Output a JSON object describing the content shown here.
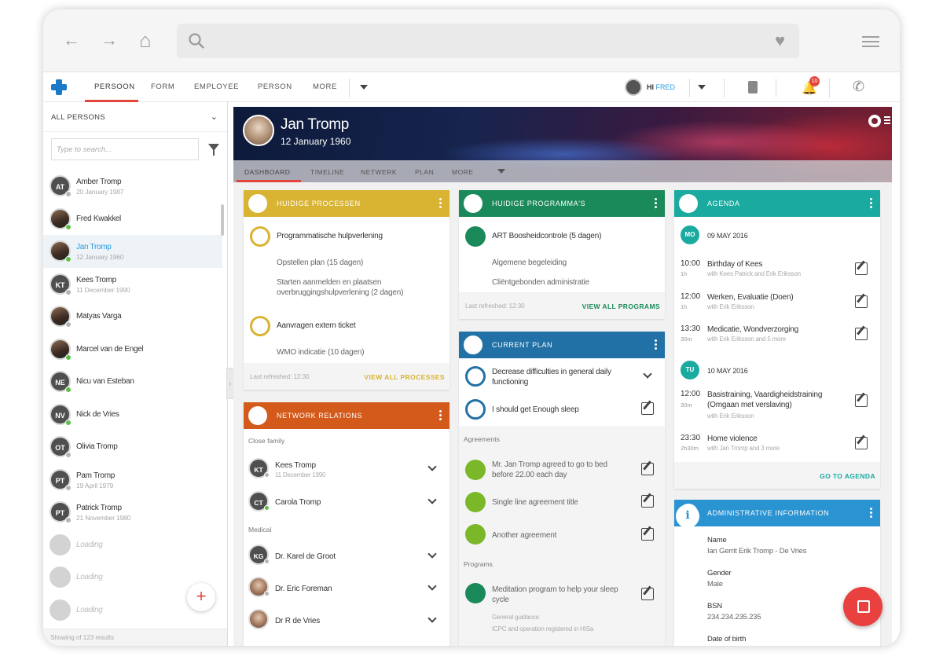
{
  "browser": {
    "back": "←",
    "forward": "→",
    "home": "⌂",
    "heart": "♥"
  },
  "app": {
    "tabs": [
      "PERSOON",
      "FORM",
      "EMPLOYEE",
      "PERSON",
      "MORE"
    ],
    "user": {
      "greeting": "HI ",
      "name": "FRED"
    },
    "notifications": "10"
  },
  "sidebar": {
    "filter_label": "ALL PERSONS",
    "search_placeholder": "Type to search...",
    "people": [
      {
        "initials": "AT",
        "name": "Amber Tromp",
        "date": "20 January 1987",
        "status": "grey"
      },
      {
        "initials": "",
        "name": "Fred Kwakkel",
        "date": "",
        "status": "green",
        "photo": true
      },
      {
        "initials": "",
        "name": "Jan Tromp",
        "date": "12 January 1960",
        "status": "green",
        "photo": true,
        "selected": true
      },
      {
        "initials": "KT",
        "name": "Kees Tromp",
        "date": "11 December 1990",
        "status": "grey"
      },
      {
        "initials": "",
        "name": "Matyas Varga",
        "date": "",
        "status": "grey",
        "photo": true
      },
      {
        "initials": "",
        "name": "Marcel van de Engel",
        "date": "",
        "status": "green",
        "photo": true
      },
      {
        "initials": "NE",
        "name": "Nicu van Esteban",
        "date": "",
        "status": "green"
      },
      {
        "initials": "NV",
        "name": "Nick de Vries",
        "date": "",
        "status": "green"
      },
      {
        "initials": "OT",
        "name": "Olivia Tromp",
        "date": "",
        "status": "grey"
      },
      {
        "initials": "PT",
        "name": "Pam Tromp",
        "date": "19 April 1979",
        "status": "grey"
      },
      {
        "initials": "PT",
        "name": "Patrick Tromp",
        "date": "21 November 1980",
        "status": "grey"
      },
      {
        "initials": "",
        "name": "Loading",
        "date": "",
        "status": "",
        "loading": true
      },
      {
        "initials": "",
        "name": "Loading",
        "date": "",
        "status": "",
        "loading": true
      },
      {
        "initials": "",
        "name": "Loading",
        "date": "",
        "status": "",
        "loading": true
      }
    ],
    "footer": "Showing of 123 results"
  },
  "profile": {
    "name": "Jan Tromp",
    "birthdate": "12 January 1960",
    "tabs": [
      "DASHBOARD",
      "TIMELINE",
      "NETWERK",
      "PLAN",
      "MORE"
    ]
  },
  "processen": {
    "title": "HUIDIGE PROCESSEN",
    "item1": "Programmatische hulpverlening",
    "sub1": "Opstellen plan (15 dagen)",
    "sub2": "Starten aanmelden en plaatsen overbruggingshulpverlening (2 dagen)",
    "item2": "Aanvragen extern ticket",
    "sub3": "WMO indicatie (10 dagen)",
    "refreshed": "Last refreshed: 12:30",
    "link": "VIEW ALL PROCESSES"
  },
  "programmas": {
    "title": "HUIDIGE PROGRAMMA'S",
    "item1": "ART Boosheidcontrole (5 dagen)",
    "sub1": "Algemene begeleiding",
    "sub2": "Cliëntgebonden administratie",
    "refreshed": "Last refreshed: 12:30",
    "link": "VIEW ALL PROGRAMS"
  },
  "agenda": {
    "title": "AGENDA",
    "day1": {
      "abbr": "MO",
      "date": "09 MAY 2016"
    },
    "day2": {
      "abbr": "TU",
      "date": "10 MAY 2016"
    },
    "events": [
      {
        "time": "10:00",
        "dur": "1h",
        "title": "Birthday of Kees",
        "sub": "with Kees Patrick and Erik Eriksson"
      },
      {
        "time": "12:00",
        "dur": "1h",
        "title": "Werken, Evaluatie (Doen)",
        "sub": "with Erik Eriksson"
      },
      {
        "time": "13:30",
        "dur": "30m",
        "title": "Medicatie, Wondverzorging",
        "sub": "with Erik Eriksson and 5 more"
      },
      {
        "time": "12:00",
        "dur": "30m",
        "title": "Basistraining, Vaardigheidstraining (Omgaan met verslaving)",
        "sub": "with Erik Eriksson"
      },
      {
        "time": "23:30",
        "dur": "2h30m",
        "title": "Home violence",
        "sub": "with Jan Tromp and 3 more"
      }
    ],
    "link": "GO TO AGENDA"
  },
  "network": {
    "title": "NETWORK RELATIONS",
    "group1": "Close family",
    "group2": "Medical",
    "relations": [
      {
        "initials": "KT",
        "name": "Kees Tromp",
        "date": "11 December 1990",
        "status": "grey"
      },
      {
        "initials": "CT",
        "name": "Carola Tromp",
        "date": "",
        "status": "green"
      },
      {
        "initials": "KG",
        "name": "Dr. Karel de Groot",
        "date": "",
        "status": "grey"
      },
      {
        "initials": "",
        "name": "Dr. Eric Foreman",
        "date": "",
        "status": "grey",
        "photo": true
      },
      {
        "initials": "",
        "name": "Dr R de Vries",
        "date": "",
        "status": "",
        "photo": true
      }
    ]
  },
  "plan": {
    "title": "CURRENT PLAN",
    "goal1": "Decrease difficulties in general daily functioning",
    "goal2": "I should get Enough sleep",
    "agreements_lbl": "Agreements",
    "agreement1": "Mr. Jan Tromp agreed to go to bed before 22.00 each day",
    "agreement2": "Single line agreement title",
    "agreement3": "Another agreement",
    "programs_lbl": "Programs",
    "program1": "Meditation program to help your sleep cycle",
    "program1_sub1": "General guidance",
    "program1_sub2": "ICPC and operation registered in HISa"
  },
  "admin": {
    "title": "ADMINISTRATIVE INFORMATION",
    "name_lbl": "Name",
    "name_val": "Ian Gerrit Erik Tromp - De Vries",
    "gender_lbl": "Gender",
    "gender_val": "Male",
    "bsn_lbl": "BSN",
    "bsn_val": "234.234.235.235",
    "dob_lbl": "Date of birth"
  }
}
